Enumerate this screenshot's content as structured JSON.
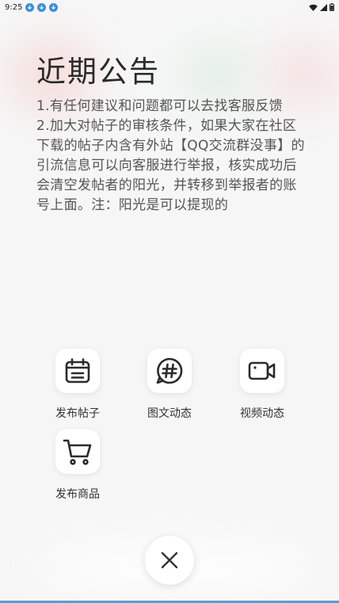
{
  "status_bar": {
    "time": "9:25",
    "notification_icons": [
      "download-notification-icon",
      "download-notification-icon",
      "download-notification-icon"
    ],
    "right_icons": [
      "wifi-icon",
      "signal-icon",
      "battery-icon"
    ]
  },
  "announcement": {
    "title": "近期公告",
    "lines": [
      "1.有任何建议和问题都可以去找客服反馈",
      "2.加大对帖子的审核条件，如果大家在社区下载的帖子内含有外站【QQ交流群没事】的引流信息可以向客服进行举报，核实成功后会清空发帖者的阳光，并转移到举报者的账号上面。注：阳光是可以提现的"
    ]
  },
  "actions": [
    {
      "label": "发布帖子",
      "icon": "post-calendar-icon"
    },
    {
      "label": "图文动态",
      "icon": "hashtag-chat-icon"
    },
    {
      "label": "视频动态",
      "icon": "video-camera-icon"
    },
    {
      "label": "发布商品",
      "icon": "shopping-cart-icon"
    }
  ],
  "close_icon": "close-icon",
  "colors": {
    "accent": "#5b9bd5",
    "icon_stroke": "#2b2b2b",
    "text": "#555555"
  }
}
